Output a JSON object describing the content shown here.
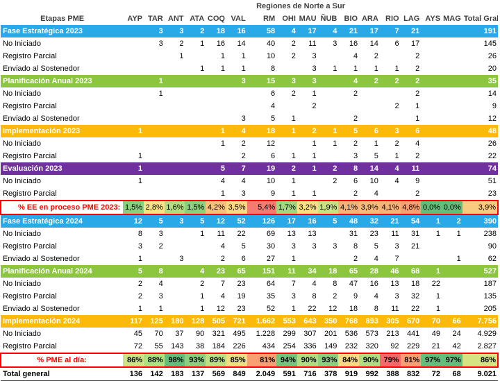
{
  "title": "Regiones de Norte a Sur",
  "stage_header": "Etapas PME",
  "columns": [
    "AYP",
    "TAR",
    "ANT",
    "ATA",
    "COQ",
    "VAL",
    "RM",
    "OHI",
    "MAU",
    "ÑUB",
    "BIO",
    "ARA",
    "RIO",
    "LAG",
    "AYS",
    "MAG",
    "Total Gral"
  ],
  "rows": [
    {
      "type": "blue",
      "cells": [
        "Fase Estratégica 2023",
        "",
        "3",
        "3",
        "2",
        "18",
        "16",
        "58",
        "4",
        "17",
        "4",
        "21",
        "17",
        "7",
        "21",
        "",
        "",
        "191"
      ]
    },
    {
      "type": "data",
      "cells": [
        "No Iniciado",
        "",
        "3",
        "2",
        "1",
        "16",
        "14",
        "40",
        "2",
        "11",
        "3",
        "16",
        "14",
        "6",
        "17",
        "",
        "",
        "145"
      ]
    },
    {
      "type": "data",
      "cells": [
        "Registro Parcial",
        "",
        "",
        "1",
        "",
        "1",
        "1",
        "10",
        "2",
        "3",
        "",
        "4",
        "2",
        "",
        "2",
        "",
        "",
        "26"
      ]
    },
    {
      "type": "data",
      "cells": [
        "Enviado al Sostenedor",
        "",
        "",
        "",
        "1",
        "1",
        "1",
        "8",
        "",
        "3",
        "1",
        "1",
        "1",
        "1",
        "2",
        "",
        "",
        "20"
      ]
    },
    {
      "type": "green",
      "cells": [
        "Planificación Anual 2023",
        "",
        "1",
        "",
        "",
        "",
        "3",
        "15",
        "3",
        "3",
        "",
        "4",
        "2",
        "2",
        "2",
        "",
        "",
        "35"
      ]
    },
    {
      "type": "data",
      "cells": [
        "No Iniciado",
        "",
        "1",
        "",
        "",
        "",
        "",
        "6",
        "2",
        "1",
        "",
        "2",
        "",
        "",
        "2",
        "",
        "",
        "14"
      ]
    },
    {
      "type": "data",
      "cells": [
        "Registro Parcial",
        "",
        "",
        "",
        "",
        "",
        "",
        "4",
        "",
        "2",
        "",
        "",
        "",
        "2",
        "1",
        "",
        "",
        "9"
      ]
    },
    {
      "type": "data",
      "cells": [
        "Enviado al Sostenedor",
        "",
        "",
        "",
        "",
        "",
        "3",
        "5",
        "1",
        "",
        "",
        "2",
        "",
        "",
        "1",
        "",
        "",
        "12"
      ]
    },
    {
      "type": "yellow",
      "cells": [
        "Implementación 2023",
        "1",
        "",
        "",
        "",
        "1",
        "4",
        "18",
        "1",
        "2",
        "1",
        "5",
        "6",
        "3",
        "6",
        "",
        "",
        "48"
      ]
    },
    {
      "type": "data",
      "cells": [
        "No Iniciado",
        "",
        "",
        "",
        "",
        "1",
        "2",
        "12",
        "",
        "1",
        "1",
        "2",
        "1",
        "2",
        "4",
        "",
        "",
        "26"
      ]
    },
    {
      "type": "data",
      "cells": [
        "Registro Parcial",
        "1",
        "",
        "",
        "",
        "",
        "2",
        "6",
        "1",
        "1",
        "",
        "3",
        "5",
        "1",
        "2",
        "",
        "",
        "22"
      ]
    },
    {
      "type": "purple",
      "cells": [
        "Evaluación 2023",
        "1",
        "",
        "",
        "",
        "5",
        "7",
        "19",
        "2",
        "1",
        "2",
        "8",
        "14",
        "4",
        "11",
        "",
        "",
        "74"
      ]
    },
    {
      "type": "data",
      "cells": [
        "No Iniciado",
        "1",
        "",
        "",
        "",
        "4",
        "4",
        "10",
        "1",
        "",
        "2",
        "6",
        "10",
        "4",
        "9",
        "",
        "",
        "51"
      ]
    },
    {
      "type": "data",
      "cells": [
        "Registro Parcial",
        "",
        "",
        "",
        "",
        "1",
        "3",
        "9",
        "1",
        "1",
        "",
        "2",
        "4",
        "",
        "2",
        "",
        "",
        "23"
      ]
    },
    {
      "type": "pct",
      "cells": [
        "% EE en proceso PME 2023:",
        "1,5%",
        "2,8%",
        "1,6%",
        "1,5%",
        "4,2%",
        "3,5%",
        "5,4%",
        "1,7%",
        "3,2%",
        "1,9%",
        "4,1%",
        "3,9%",
        "4,1%",
        "4,8%",
        "0,0%",
        "0,0%",
        "3,9%"
      ]
    },
    {
      "type": "blue",
      "cells": [
        "Fase Estratégica 2024",
        "12",
        "5",
        "3",
        "5",
        "12",
        "52",
        "126",
        "17",
        "16",
        "5",
        "48",
        "32",
        "21",
        "54",
        "1",
        "2",
        "390"
      ]
    },
    {
      "type": "data",
      "cells": [
        "No Iniciado",
        "8",
        "3",
        "",
        "1",
        "11",
        "22",
        "69",
        "13",
        "13",
        "",
        "31",
        "23",
        "11",
        "31",
        "1",
        "1",
        "238"
      ]
    },
    {
      "type": "data",
      "cells": [
        "Registro Parcial",
        "3",
        "2",
        "",
        "",
        "4",
        "5",
        "30",
        "3",
        "3",
        "3",
        "8",
        "5",
        "3",
        "21",
        "",
        "",
        "90"
      ]
    },
    {
      "type": "data",
      "cells": [
        "Enviado al Sostenedor",
        "1",
        "",
        "3",
        "",
        "2",
        "6",
        "27",
        "1",
        "",
        "",
        "2",
        "4",
        "7",
        "",
        "",
        "1",
        "62"
      ]
    },
    {
      "type": "green",
      "cells": [
        "Planificación Anual 2024",
        "5",
        "8",
        "",
        "4",
        "23",
        "65",
        "151",
        "11",
        "34",
        "18",
        "65",
        "28",
        "46",
        "68",
        "1",
        "",
        "527"
      ]
    },
    {
      "type": "data",
      "cells": [
        "No Iniciado",
        "2",
        "4",
        "",
        "2",
        "7",
        "23",
        "64",
        "7",
        "4",
        "8",
        "47",
        "16",
        "13",
        "18",
        "22",
        "",
        "187"
      ]
    },
    {
      "type": "data",
      "cells": [
        "Registro Parcial",
        "2",
        "3",
        "",
        "1",
        "4",
        "19",
        "35",
        "3",
        "8",
        "2",
        "9",
        "4",
        "3",
        "32",
        "1",
        "",
        "135"
      ]
    },
    {
      "type": "data",
      "cells": [
        "Enviado al Sostenedor",
        "1",
        "1",
        "",
        "1",
        "12",
        "23",
        "52",
        "1",
        "22",
        "12",
        "18",
        "8",
        "11",
        "22",
        "1",
        "",
        "205"
      ]
    },
    {
      "type": "yellow",
      "cells": [
        "Implementación 2024",
        "117",
        "125",
        "180",
        "128",
        "505",
        "721",
        "1.662",
        "553",
        "643",
        "350",
        "768",
        "893",
        "305",
        "670",
        "70",
        "66",
        "7.756"
      ]
    },
    {
      "type": "data",
      "cells": [
        "No Iniciado",
        "45",
        "70",
        "37",
        "90",
        "321",
        "495",
        "1.228",
        "299",
        "307",
        "201",
        "536",
        "573",
        "213",
        "441",
        "49",
        "24",
        "4.929"
      ]
    },
    {
      "type": "data",
      "cells": [
        "Registro Parcial",
        "72",
        "55",
        "143",
        "38",
        "184",
        "226",
        "434",
        "254",
        "336",
        "149",
        "232",
        "320",
        "92",
        "229",
        "21",
        "42",
        "2.827"
      ]
    },
    {
      "type": "pct2",
      "cells": [
        "% PME al día:",
        "86%",
        "88%",
        "98%",
        "93%",
        "89%",
        "85%",
        "81%",
        "94%",
        "90%",
        "93%",
        "84%",
        "90%",
        "79%",
        "81%",
        "97%",
        "97%",
        "86%"
      ]
    },
    {
      "type": "total",
      "cells": [
        "Total general",
        "136",
        "142",
        "183",
        "137",
        "569",
        "849",
        "2.049",
        "591",
        "716",
        "378",
        "919",
        "992",
        "388",
        "832",
        "72",
        "68",
        "9.021"
      ]
    }
  ],
  "pct_colors_2023": [
    "#8ccf7e",
    "#f7e38a",
    "#b4dc82",
    "#8ccf7e",
    "#f9c07c",
    "#fbd884",
    "#f77a72",
    "#a3d67f",
    "#f9df86",
    "#c9e283",
    "#f7b27a",
    "#f9bb7c",
    "#f7b27a",
    "#f8a074",
    "#63be7b",
    "#63be7b",
    "#f9cb80"
  ],
  "pct_colors_2024": [
    "#cee383",
    "#ade283",
    "#63be7b",
    "#8ccf7e",
    "#bde082",
    "#eee082",
    "#f8a074",
    "#74c47c",
    "#b2dc82",
    "#8ccf7e",
    "#fbd884",
    "#b2dc82",
    "#f8696b",
    "#f8a074",
    "#63be7b",
    "#63be7b",
    "#d6e383"
  ]
}
